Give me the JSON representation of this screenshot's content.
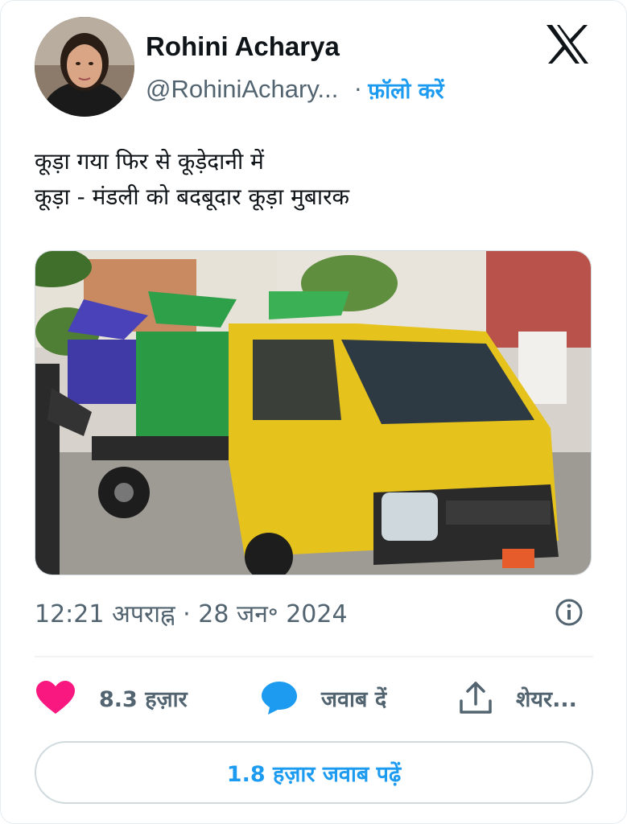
{
  "author": {
    "display_name": "Rohini Acharya",
    "handle": "@RohiniAchary...",
    "follow_label": "फ़ॉलो करें",
    "avatar_icon": "profile-photo"
  },
  "header": {
    "brand_icon": "x-logo-icon"
  },
  "tweet": {
    "lines": [
      "कूड़ा गया फिर से कूड़ेदानी में",
      "कूड़ा - मंडली को बदबूदार कूड़ा मुबारक"
    ],
    "media_description_icon": "photo-garbage-truck",
    "timestamp": "12:21 अपराह्न · 28 जन॰ 2024"
  },
  "actions": {
    "like_count": "8.3 हज़ार",
    "reply_label": "जवाब दें",
    "share_label": "शेयर..."
  },
  "read_replies_label": "1.8 हज़ार जवाब पढ़ें",
  "colors": {
    "accent": "#1d9bf0",
    "like": "#f91880",
    "text": "#0f1419",
    "secondary": "#536471"
  }
}
